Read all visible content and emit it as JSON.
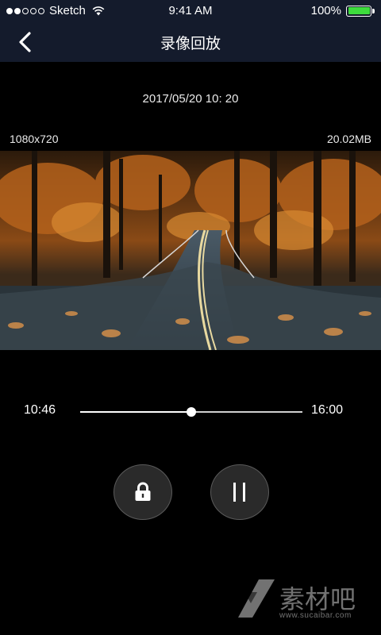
{
  "status_bar": {
    "carrier": "Sketch",
    "time": "9:41 AM",
    "battery_percent": "100%",
    "signal_dots_filled": 2,
    "signal_dots_total": 5,
    "battery_color": "#3ddc3d",
    "battery_level": 1.0
  },
  "nav": {
    "title": "录像回放",
    "back_icon": "chevron-left-icon"
  },
  "recording": {
    "datetime": "2017/05/20 10: 20",
    "resolution": "1080x720",
    "file_size": "20.02MB"
  },
  "player": {
    "current_time": "10:46",
    "total_time": "16:00",
    "progress_fraction": 0.5
  },
  "controls": {
    "lock_icon": "lock-icon",
    "pause_icon": "pause-icon"
  },
  "watermark": {
    "text": "素材吧",
    "url": "www.sucaibar.com"
  },
  "colors": {
    "bar_background": "#141b2c",
    "page_background": "#000000",
    "control_background": "#2a2a2a"
  }
}
